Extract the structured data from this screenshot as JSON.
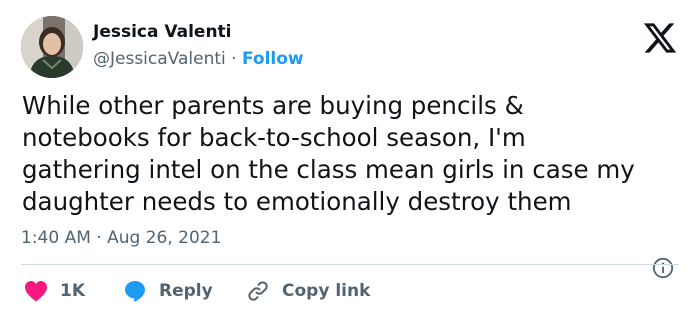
{
  "author": {
    "name": "Jessica Valenti",
    "handle": "@JessicaValenti",
    "separator": "·",
    "follow_label": "Follow"
  },
  "tweet": {
    "lines": [
      "While other parents are buying pencils &",
      "notebooks for back-to-school season, I'm",
      "gathering intel on the class mean girls in case my",
      "daughter needs to emotionally destroy them"
    ],
    "timestamp": "1:40 AM · Aug 26, 2021"
  },
  "actions": {
    "like_count": "1K",
    "reply_label": "Reply",
    "copy_label": "Copy link"
  },
  "icons": {
    "logo": "x-logo-icon",
    "info": "info-icon",
    "like": "heart-icon",
    "reply": "speech-bubble-icon",
    "copy": "link-icon"
  },
  "colors": {
    "text": "#0f1419",
    "secondary": "#536471",
    "accent": "#1d9bf0",
    "like": "#f91880",
    "divider": "#cfd9de"
  }
}
